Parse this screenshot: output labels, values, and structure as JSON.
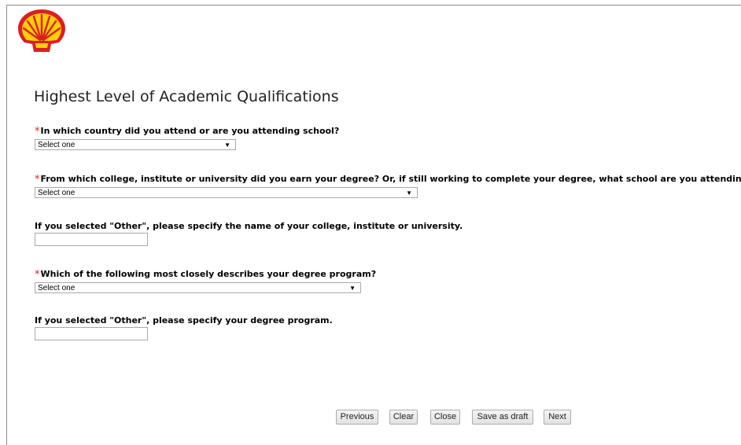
{
  "brand": {
    "logo_icon": "shell-pecten-logo",
    "colors": {
      "red": "#dd1d21",
      "yellow": "#fbce07"
    }
  },
  "page": {
    "title": "Highest Level of Academic Qualifications"
  },
  "form": {
    "required_marker": "*",
    "country": {
      "label": "In which country did you attend or are you attending school?",
      "value": "Select one"
    },
    "college": {
      "label": "From which college, institute or university did you earn your degree? Or, if still working to complete your degree, what school are you attending?",
      "value": "Select one"
    },
    "college_other": {
      "label": "If you selected \"Other\", please specify the name of your college, institute or university.",
      "value": ""
    },
    "degree_program": {
      "label": "Which of the following most closely describes your degree program?",
      "value": "Select one"
    },
    "degree_other": {
      "label": "If you selected \"Other\", please specify your degree program.",
      "value": ""
    }
  },
  "buttons": {
    "previous": "Previous",
    "clear": "Clear",
    "close": "Close",
    "save_draft": "Save as draft",
    "next": "Next"
  }
}
